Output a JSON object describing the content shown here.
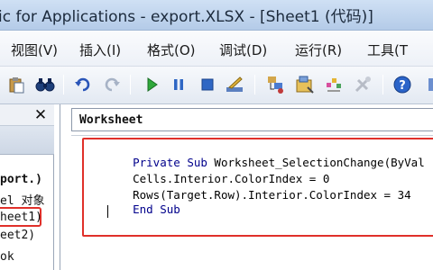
{
  "window": {
    "title": "ic for Applications - export.XLSX - [Sheet1 (代码)]"
  },
  "menu": [
    {
      "label": "视图(V)"
    },
    {
      "label": "插入(I)"
    },
    {
      "label": "格式(O)"
    },
    {
      "label": "调试(D)"
    },
    {
      "label": "运行(R)"
    },
    {
      "label": "工具(T"
    }
  ],
  "toolbar": {
    "icons": [
      "paste-icon",
      "find-icon",
      "undo-icon",
      "redo-icon",
      "run-icon",
      "break-icon",
      "reset-icon",
      "design-mode-icon",
      "project-explorer-icon",
      "properties-icon",
      "object-browser-icon",
      "toolbox-icon",
      "help-icon"
    ]
  },
  "project_pane": {
    "close_label": "✕",
    "items": [
      {
        "label": "port.)"
      },
      {
        "label": "el 对象"
      },
      {
        "label": "heet1)"
      },
      {
        "label": "eet2)"
      },
      {
        "label": "ok"
      }
    ]
  },
  "code_window": {
    "object_combo": "Worksheet",
    "lines": [
      {
        "kw": "Private Sub",
        "rest": " Worksheet_SelectionChange(ByVal"
      },
      {
        "kw": "",
        "rest": "Cells.Interior.ColorIndex = 0"
      },
      {
        "kw": "",
        "rest": "Rows(Target.Row).Interior.ColorIndex = 34"
      },
      {
        "kw": "End Sub",
        "rest": ""
      }
    ]
  },
  "colors": {
    "highlight": "#e0302a",
    "keyword": "#00008b"
  }
}
